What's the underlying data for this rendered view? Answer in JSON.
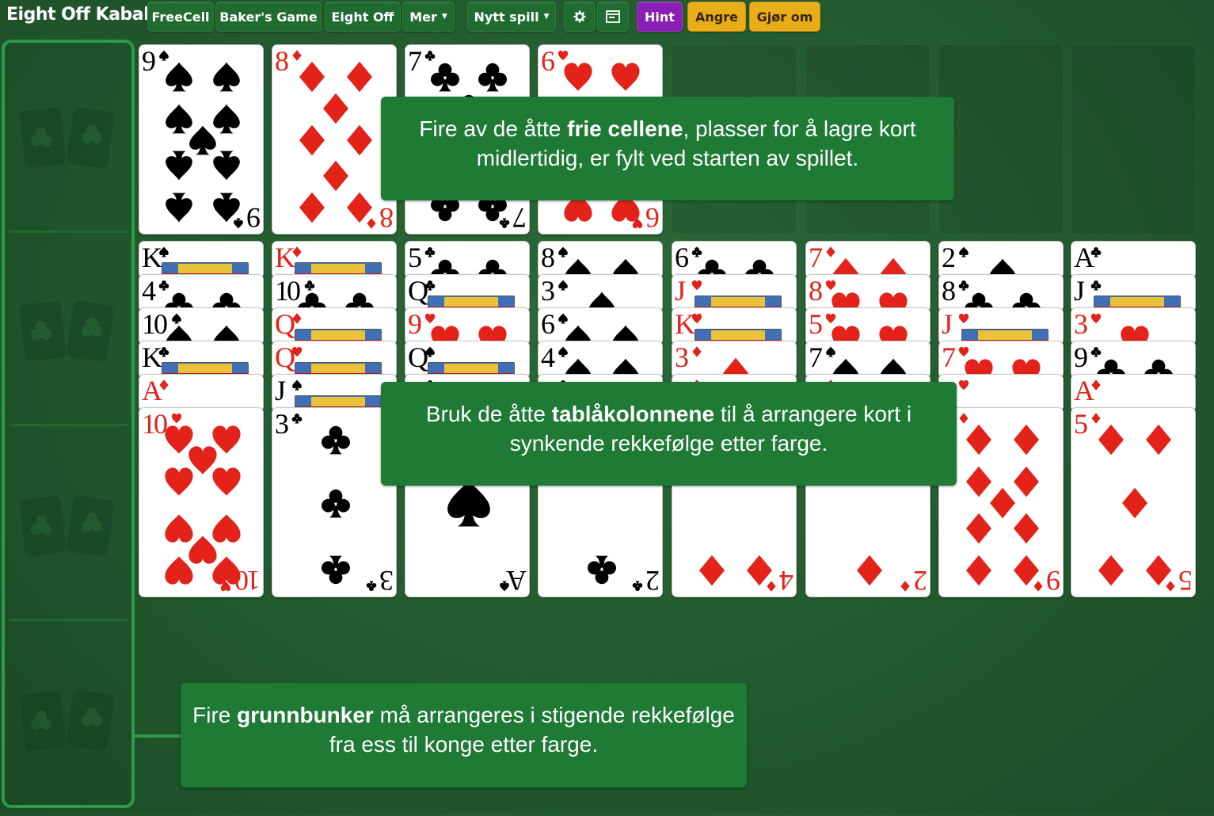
{
  "app_title": "Eight Off Kabal",
  "toolbar": {
    "variants": [
      "FreeCell",
      "Baker's Game",
      "Eight Off"
    ],
    "more_label": "Mer",
    "new_game_label": "Nytt spill",
    "settings_icon": "gear-icon",
    "layout_icon": "window-icon",
    "hint_label": "Hint",
    "undo_label": "Angre",
    "redo_label": "Gjør om"
  },
  "colors": {
    "table_green": "#235a2e",
    "callout_green": "#1e7a35",
    "hint_purple": "#8a1fb5",
    "undo_yellow": "#e9ad1a",
    "red_suit": "#e32219"
  },
  "free_cells": [
    {
      "rank": "9",
      "suit": "spade"
    },
    {
      "rank": "8",
      "suit": "diamond"
    },
    {
      "rank": "7",
      "suit": "club"
    },
    {
      "rank": "6",
      "suit": "heart"
    },
    null,
    null,
    null,
    null
  ],
  "tableau": [
    [
      {
        "rank": "K",
        "suit": "spade"
      },
      {
        "rank": "4",
        "suit": "club"
      },
      {
        "rank": "10",
        "suit": "spade"
      },
      {
        "rank": "K",
        "suit": "club"
      },
      {
        "rank": "A",
        "suit": "diamond"
      },
      {
        "rank": "10",
        "suit": "heart"
      }
    ],
    [
      {
        "rank": "K",
        "suit": "diamond"
      },
      {
        "rank": "10",
        "suit": "club"
      },
      {
        "rank": "Q",
        "suit": "diamond"
      },
      {
        "rank": "Q",
        "suit": "heart"
      },
      {
        "rank": "J",
        "suit": "spade"
      },
      {
        "rank": "3",
        "suit": "club"
      }
    ],
    [
      {
        "rank": "5",
        "suit": "club"
      },
      {
        "rank": "Q",
        "suit": "club"
      },
      {
        "rank": "9",
        "suit": "heart"
      },
      {
        "rank": "Q",
        "suit": "spade"
      },
      {
        "rank": "",
        "suit": "club"
      },
      {
        "rank": "A",
        "suit": "spade"
      }
    ],
    [
      {
        "rank": "8",
        "suit": "spade"
      },
      {
        "rank": "3",
        "suit": "spade"
      },
      {
        "rank": "6",
        "suit": "spade"
      },
      {
        "rank": "4",
        "suit": "spade"
      },
      {
        "rank": "",
        "suit": "club"
      },
      {
        "rank": "2",
        "suit": "club"
      }
    ],
    [
      {
        "rank": "6",
        "suit": "club"
      },
      {
        "rank": "J",
        "suit": "heart"
      },
      {
        "rank": "K",
        "suit": "heart"
      },
      {
        "rank": "3",
        "suit": "diamond"
      },
      {
        "rank": "",
        "suit": "diamond"
      },
      {
        "rank": "4",
        "suit": "diamond"
      }
    ],
    [
      {
        "rank": "7",
        "suit": "diamond"
      },
      {
        "rank": "8",
        "suit": "heart"
      },
      {
        "rank": "5",
        "suit": "heart"
      },
      {
        "rank": "7",
        "suit": "spade"
      },
      {
        "rank": "",
        "suit": "diamond"
      },
      {
        "rank": "2",
        "suit": "diamond"
      }
    ],
    [
      {
        "rank": "2",
        "suit": "spade"
      },
      {
        "rank": "8",
        "suit": "club"
      },
      {
        "rank": "J",
        "suit": "heart"
      },
      {
        "rank": "7",
        "suit": "heart"
      },
      {
        "rank": "",
        "suit": "heart"
      },
      {
        "rank": "9",
        "suit": "diamond"
      }
    ],
    [
      {
        "rank": "A",
        "suit": "club"
      },
      {
        "rank": "J",
        "suit": "club"
      },
      {
        "rank": "3",
        "suit": "heart"
      },
      {
        "rank": "9",
        "suit": "club"
      },
      {
        "rank": "A",
        "suit": "diamond"
      },
      {
        "rank": "5",
        "suit": "diamond"
      }
    ]
  ],
  "callouts": {
    "free_cells": {
      "pre": "Fire av de åtte ",
      "bold": "frie cellene",
      "post": ", plasser for å lagre kort midlertidig, er fylt ved starten av spillet."
    },
    "tableau": {
      "pre": "Bruk de åtte ",
      "bold": "tablåkolonnene",
      "post": " til å arrangere kort i synkende rekkefølge etter farge."
    },
    "foundations": {
      "pre": "Fire ",
      "bold": "grunnbunker",
      "post": " må arrangeres i stigende rekkefølge fra ess til konge etter farge."
    }
  }
}
